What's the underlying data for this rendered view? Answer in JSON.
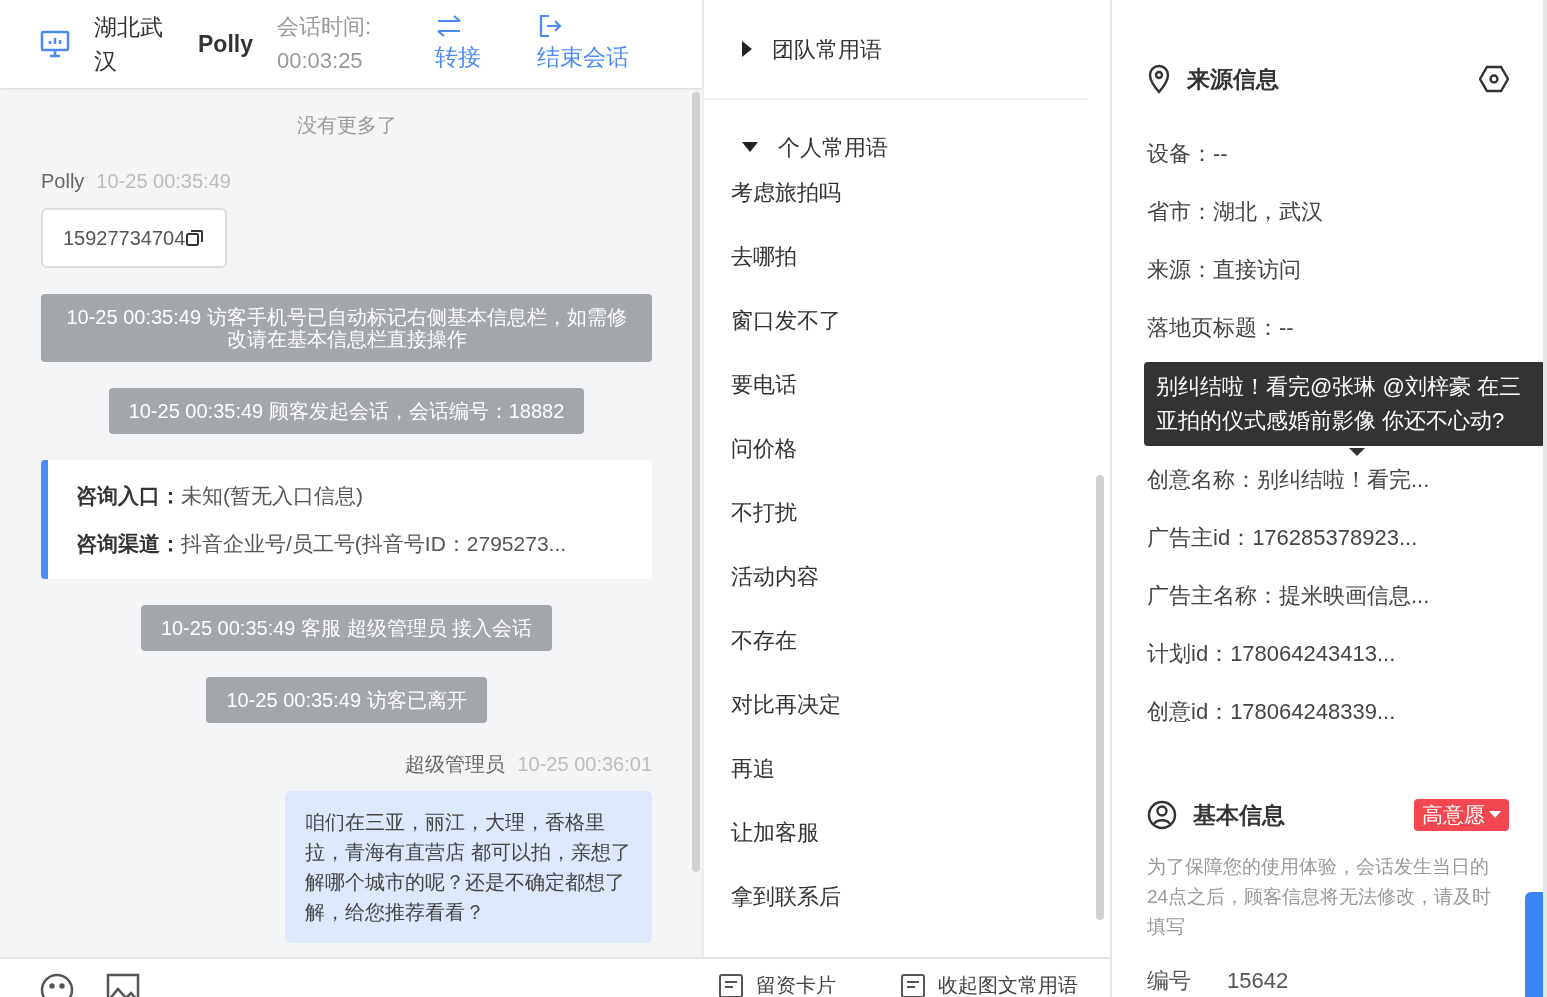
{
  "header": {
    "location": "湖北武汉",
    "visitor": "Polly",
    "duration_label": "会话时间:",
    "duration": "00:03:25",
    "actions": [
      {
        "kind": "transfer",
        "label": "转接"
      },
      {
        "kind": "end",
        "label": "结束会话"
      }
    ]
  },
  "chat": [
    {
      "kind": "notice",
      "text": "没有更多了"
    },
    {
      "kind": "visitor_msg",
      "sender": "Polly",
      "time": "10-25 00:35:49",
      "text": "15927734704"
    },
    {
      "kind": "system",
      "text": "10-25 00:35:49 访客手机号已自动标记右侧基本信息栏，如需修改请在基本信息栏直接操作"
    },
    {
      "kind": "system",
      "text": "10-25 00:35:49 顾客发起会话，会话编号：18882"
    },
    {
      "kind": "entry_card",
      "rows": [
        {
          "label": "咨询入口：",
          "value": "未知(暂无入口信息)"
        },
        {
          "label": "咨询渠道：",
          "value": "抖音企业号/员工号(抖音号ID：2795273..."
        }
      ]
    },
    {
      "kind": "system",
      "text": "10-25 00:35:49 客服 超级管理员 接入会话"
    },
    {
      "kind": "system",
      "text": "10-25 00:35:49 访客已离开"
    },
    {
      "kind": "agent_msg",
      "sender": "超级管理员",
      "time": "10-25 00:36:01",
      "text": "咱们在三亚，丽江，大理，香格里拉，青海有直营店 都可以拍，亲想了解哪个城市的呢？还是不确定都想了解，给您推荐看看？"
    }
  ],
  "phrases": {
    "groups": [
      {
        "title": "团队常用语",
        "expanded": false
      },
      {
        "title": "个人常用语",
        "expanded": true,
        "items": [
          "考虑旅拍吗",
          "去哪拍",
          "窗口发不了",
          "要电话",
          "问价格",
          "不打扰",
          "活动内容",
          "不存在",
          "对比再决定",
          "再追",
          "让加客服",
          "拿到联系后"
        ]
      }
    ]
  },
  "toolbar": {
    "right": [
      "留资卡片",
      "收起图文常用语"
    ]
  },
  "source_info": {
    "title": "来源信息",
    "fields": [
      {
        "label": "设备：",
        "value": "--"
      },
      {
        "label": "省市：",
        "value": "湖北，武汉"
      },
      {
        "label": "来源：",
        "value": "直接访问"
      },
      {
        "label": "落地页标题：",
        "value": "--"
      }
    ],
    "tooltip": [
      "别纠结啦！看完@张琳 @刘梓豪 在三",
      "亚拍的仪式感婚前影像 你还不心动?"
    ],
    "fields_after": [
      {
        "label": "创意名称：",
        "value": "别纠结啦！看完..."
      },
      {
        "label": "广告主id：",
        "value": "176285378923..."
      },
      {
        "label": "广告主名称：",
        "value": "提米映画信息..."
      },
      {
        "label": "计划id：",
        "value": "178064243413..."
      },
      {
        "label": "创意id：",
        "value": "178064248339..."
      }
    ]
  },
  "basic_info": {
    "title": "基本信息",
    "intent": "高意愿",
    "note": "为了保障您的使用体验，会话发生当日的24点之后，顾客信息将无法修改，请及时填写",
    "fields": [
      {
        "label": "编号",
        "value": "15642"
      }
    ]
  }
}
